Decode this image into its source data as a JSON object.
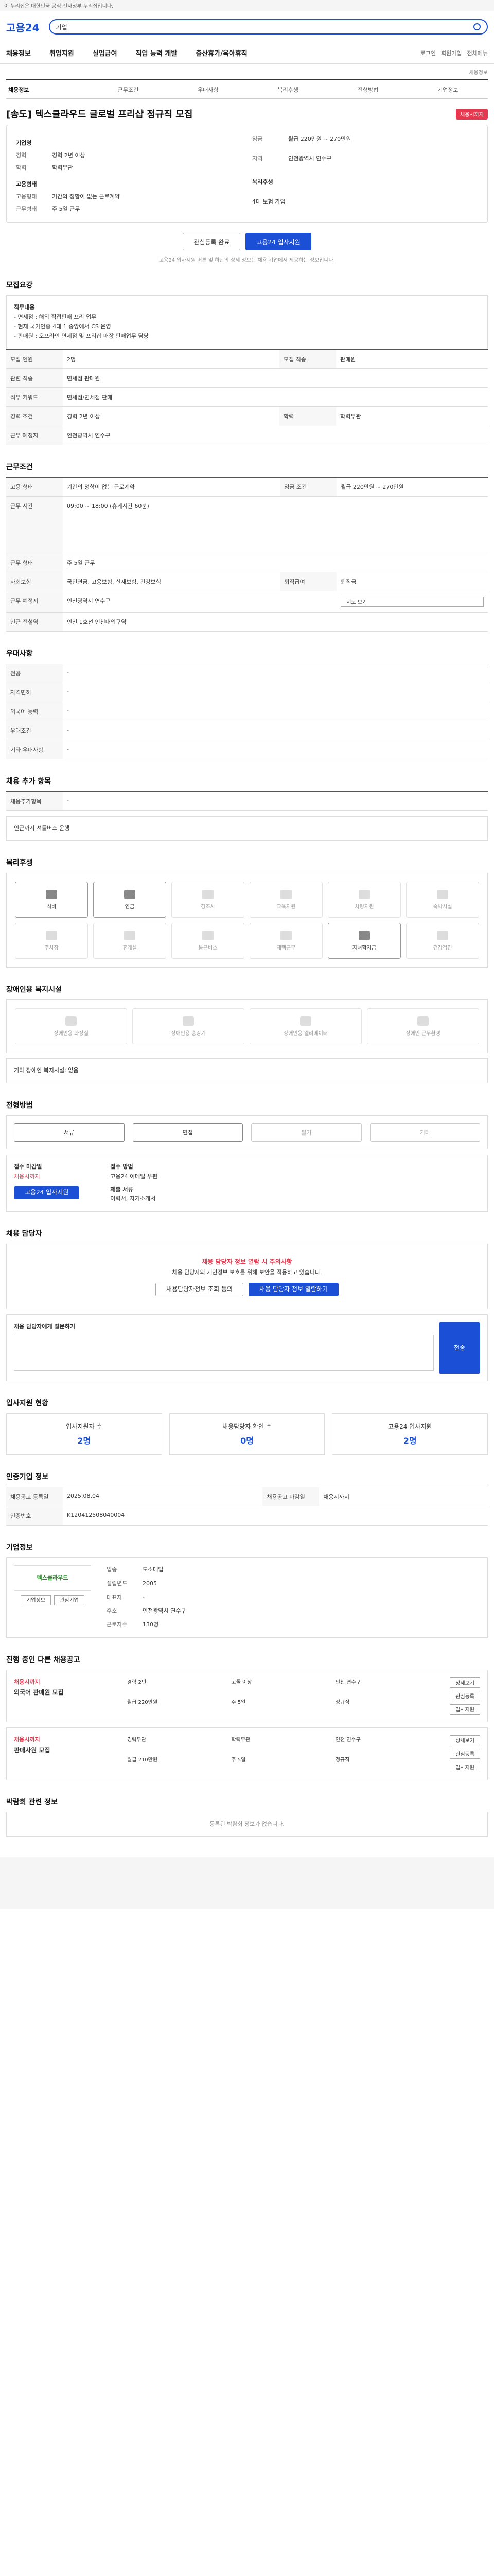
{
  "topbar": {
    "text": "이 누리집은 대한민국 공식 전자정부 누리집입니다."
  },
  "header": {
    "logo": "고용24",
    "search_value": "기업"
  },
  "gnb": {
    "items": [
      "채용정보",
      "취업지원",
      "실업급여",
      "직업 능력 개발",
      "출산휴가/육아휴직"
    ],
    "util": [
      "로그인",
      "회원가입",
      "전체메뉴"
    ]
  },
  "tabs": [
    "채용정보",
    "근무조건",
    "우대사항",
    "복리후생",
    "전형방법",
    "기업정보"
  ],
  "job": {
    "title": "[송도] 텍스클라우드 글로벌 프리샵 정규직 모집",
    "badge": "채용시까지",
    "company_label": "기업명",
    "rows": [
      {
        "k": "경력",
        "v": "경력 2년 이상"
      },
      {
        "k": "학력",
        "v": "학력무관"
      },
      {
        "k": "임금",
        "v": "월급 220만원 ~ 270만원"
      },
      {
        "k": "지역",
        "v": "인천광역시 연수구"
      }
    ],
    "conditions_label": "고용형태",
    "conditions": [
      {
        "k": "고용형태",
        "v": "기간의 정함이 없는 근로계약"
      },
      {
        "k": "근무형태",
        "v": "주 5일 근무"
      }
    ],
    "benefit_label": "복리후생",
    "benefit": "4대 보험 가입"
  },
  "actions": {
    "scrap": "관심등록 완료",
    "apply": "고용24 입사지원"
  },
  "notice": "고용24 입사지원 버튼 및 하단의 상세 정보는 채용 기업에서 제공하는 정보입니다.",
  "sections": {
    "detail": "모집요강",
    "cond": "근무조건",
    "pref": "우대사항",
    "extra": "채용 추가 항목",
    "benefit": "복리후생",
    "facility": "장애인용 복지시설",
    "apply": "전형방법",
    "contact": "채용 담당자",
    "status": "입사지원 현황",
    "info": "인증기업 정보",
    "company": "기업정보",
    "other": "진행 중인 다른 채용공고",
    "expo": "박람회 관련 정보"
  },
  "detail": {
    "title": "직무내용",
    "lines": [
      "- 면세점 : 해외 직접판매 프리 업무",
      "- 현재 국가인증 4대 1 중앙에서 CS 운영",
      "- 판매원 : 오프라인 면세점 및 프리샵 매장 판매업무 담당"
    ],
    "rows": [
      {
        "k": "모집 인원",
        "v": "2명"
      },
      {
        "k": "모집 직종",
        "v": "판매원"
      },
      {
        "k": "관련 직종",
        "v": "면세점 판매원"
      },
      {
        "k": "직무 키워드",
        "v": "면세점/면세점 판매"
      },
      {
        "k": "경력 조건",
        "v": "경력 2년 이상"
      },
      {
        "k": "학력",
        "v": "학력무관"
      },
      {
        "k": "근무 예정지",
        "v": "인천광역시 연수구"
      }
    ]
  },
  "cond": {
    "rows": [
      {
        "k": "고용 형태",
        "v": "기간의 정함이 없는 근로계약"
      },
      {
        "k": "임금 조건",
        "v": "월급 220만원 ~ 270만원"
      },
      {
        "k": "근무 시간",
        "v": "09:00 ~ 18:00 (휴게시간 60분)"
      },
      {
        "k": "근무 형태",
        "v": "주 5일 근무"
      },
      {
        "k": "사회보험",
        "v": "국민연금, 고용보험, 산재보험, 건강보험"
      },
      {
        "k": "퇴직급여",
        "v": "퇴직금"
      },
      {
        "k": "근무 예정지",
        "v": "인천광역시 연수구"
      },
      {
        "k": "인근 전철역",
        "v": "인천 1호선 인천대입구역"
      }
    ],
    "map_btn": "지도 보기"
  },
  "pref": {
    "rows": [
      {
        "k": "전공",
        "v": "-"
      },
      {
        "k": "자격면허",
        "v": "-"
      },
      {
        "k": "외국어 능력",
        "v": "-"
      },
      {
        "k": "우대조건",
        "v": "-"
      },
      {
        "k": "기타 우대사항",
        "v": "-"
      }
    ]
  },
  "extra": {
    "rows": [
      {
        "k": "채용추가항목",
        "v": "-"
      }
    ],
    "text": "인근까지 셔틀버스 운행"
  },
  "benefit": {
    "items": [
      "식비",
      "연금",
      "경조사",
      "교육지원",
      "차량지원",
      "숙박시설",
      "주차장",
      "휴게실",
      "통근버스",
      "재택근무",
      "자녀학자금",
      "건강검진"
    ]
  },
  "facility": {
    "items": [
      "장애인용 화장실",
      "장애인용 승강기",
      "장애인용 엘리베이터",
      "장애인 근무환경"
    ],
    "none": "기타 장애인 복지시설: 없음"
  },
  "apply": {
    "methods": [
      "서류",
      "면접",
      "필기",
      "기타"
    ],
    "receipt_label": "접수 마감일",
    "receipt": "채용시까지",
    "apply_btn": "고용24 입사지원",
    "way_label": "접수 방법",
    "way": "고용24 이메일 우편",
    "doc_label": "제출 서류",
    "doc": "이력서, 자기소개서"
  },
  "contact": {
    "title": "채용 담당자 정보 열람 시 주의사항",
    "body": "채용 담당자의 개인정보 보호를 위해 보안을 적용하고 있습니다.",
    "btn1": "채용담당자정보 조회 동의",
    "btn2": "채용 담당자 정보 열람하기",
    "ask": "채용 담당자에게 질문하기",
    "ask_btn": "전송"
  },
  "status": {
    "items": [
      {
        "k": "입사지원자 수",
        "v": "2명"
      },
      {
        "k": "채용담당자 확인 수",
        "v": "0명"
      },
      {
        "k": "고용24 입사지원",
        "v": "2명"
      }
    ]
  },
  "info": {
    "rows": [
      {
        "k": "채용공고 등록일",
        "v": "2025.08.04"
      },
      {
        "k": "채용공고 마감일",
        "v": "채용시까지"
      },
      {
        "k": "인증번호",
        "v": "K120412508040004"
      }
    ]
  },
  "company": {
    "name": "텍스클라우드",
    "rows": [
      {
        "k": "업종",
        "v": "도소매업"
      },
      {
        "k": "설립년도",
        "v": "2005"
      },
      {
        "k": "대표자",
        "v": "-"
      },
      {
        "k": "주소",
        "v": "인천광역시 연수구"
      },
      {
        "k": "근로자수",
        "v": "130명"
      }
    ],
    "btn1": "기업정보",
    "btn2": "관심기업"
  },
  "other": {
    "items": [
      {
        "c": "채용시까지",
        "t": "외국어 판매원 모집",
        "d": [
          "경력 2년",
          "고졸 이상",
          "인천 연수구",
          "월급 220만원",
          "주 5일",
          "정규직"
        ]
      },
      {
        "c": "채용시까지",
        "t": "판매사원 모집",
        "d": [
          "경력무관",
          "학력무관",
          "인천 연수구",
          "월급 210만원",
          "주 5일",
          "정규직"
        ]
      }
    ],
    "btns": [
      "상세보기",
      "관심등록",
      "입사지원"
    ]
  },
  "expo": {
    "text": "등록된 박람회 정보가 없습니다."
  }
}
